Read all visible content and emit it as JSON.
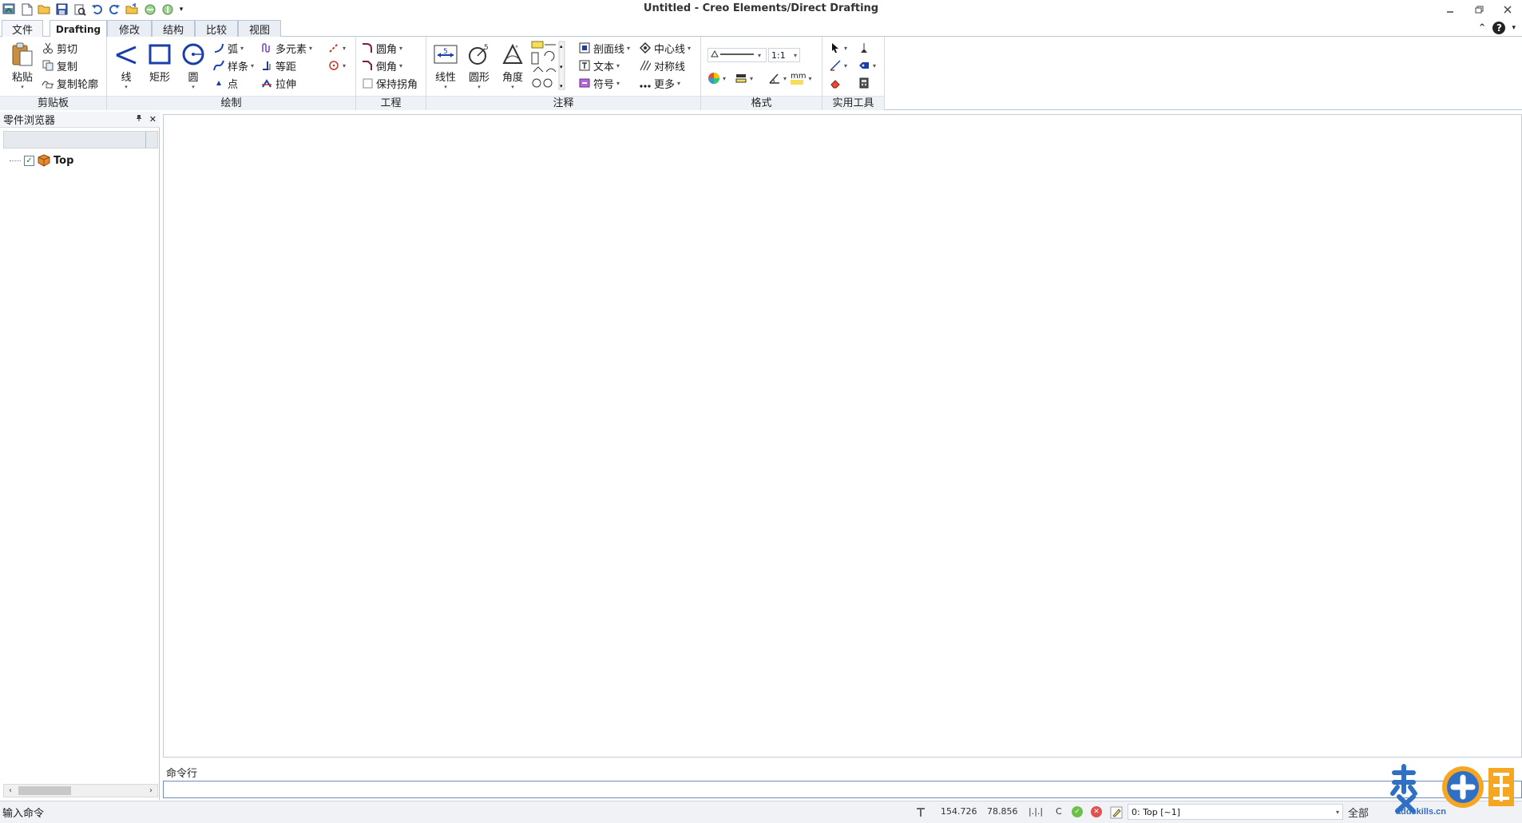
{
  "window": {
    "title": "Untitled - Creo Elements/Direct Drafting",
    "controls": {
      "minimize": "▭",
      "restore": "⧉",
      "close": "✕"
    }
  },
  "quick_access": [
    "app-menu-icon",
    "new-file-icon",
    "open-file-icon",
    "save-icon",
    "print-preview-icon",
    "undo-icon",
    "redo-icon",
    "open-folder-icon",
    "sphere-left-icon",
    "sphere-right-icon",
    "customize-dropdown-icon"
  ],
  "tabs": [
    {
      "id": "file",
      "label": "文件"
    },
    {
      "id": "drafting",
      "label": "Drafting"
    },
    {
      "id": "modify",
      "label": "修改"
    },
    {
      "id": "structure",
      "label": "结构"
    },
    {
      "id": "compare",
      "label": "比较"
    },
    {
      "id": "view",
      "label": "视图"
    }
  ],
  "tab_right": {
    "collapse": "⌃",
    "help": "?"
  },
  "ribbon": {
    "clipboard": {
      "label": "剪贴板",
      "paste": "粘贴",
      "cut": "剪切",
      "copy": "复制",
      "copy_outline": "复制轮廓"
    },
    "draw": {
      "label": "绘制",
      "line": "线",
      "rectangle": "矩形",
      "circle": "圆",
      "arc": "弧",
      "spline": "样条",
      "point": "点",
      "multi_element": "多元素",
      "equidistant": "等距",
      "stretch": "拉伸"
    },
    "engineering": {
      "label": "工程",
      "fillet": "圆角",
      "chamfer": "倒角",
      "keep_corner": "保持拐角"
    },
    "annotation": {
      "label": "注释",
      "linear": "线性",
      "circular": "圆形",
      "angle": "角度",
      "section_line": "剖面线",
      "text": "文本",
      "symbol": "符号",
      "centerline": "中心线",
      "symmetry_line": "对称线",
      "more": "更多"
    },
    "format": {
      "label": "格式",
      "scale": "1:1",
      "unit": "mm"
    },
    "utilities": {
      "label": "实用工具"
    }
  },
  "part_browser": {
    "title": "零件浏览器",
    "pin": "ᵖ",
    "close": "✕",
    "tree": [
      {
        "label": "Top",
        "checked": true
      }
    ]
  },
  "command_line": {
    "label": "命令行",
    "value": ""
  },
  "status": {
    "prompt": "输入命令",
    "x": "154.726",
    "y": "78.856",
    "grid": "|.|.|",
    "c_label": "C",
    "part_selector": "0: Top [~1]",
    "filter": "全部"
  },
  "watermark": {
    "text": "addskills.cn"
  },
  "colors": {
    "accent": "#2f6fc4",
    "tab_border": "#b9c6d6",
    "ribbon_label_bg": "#eef2f7"
  }
}
